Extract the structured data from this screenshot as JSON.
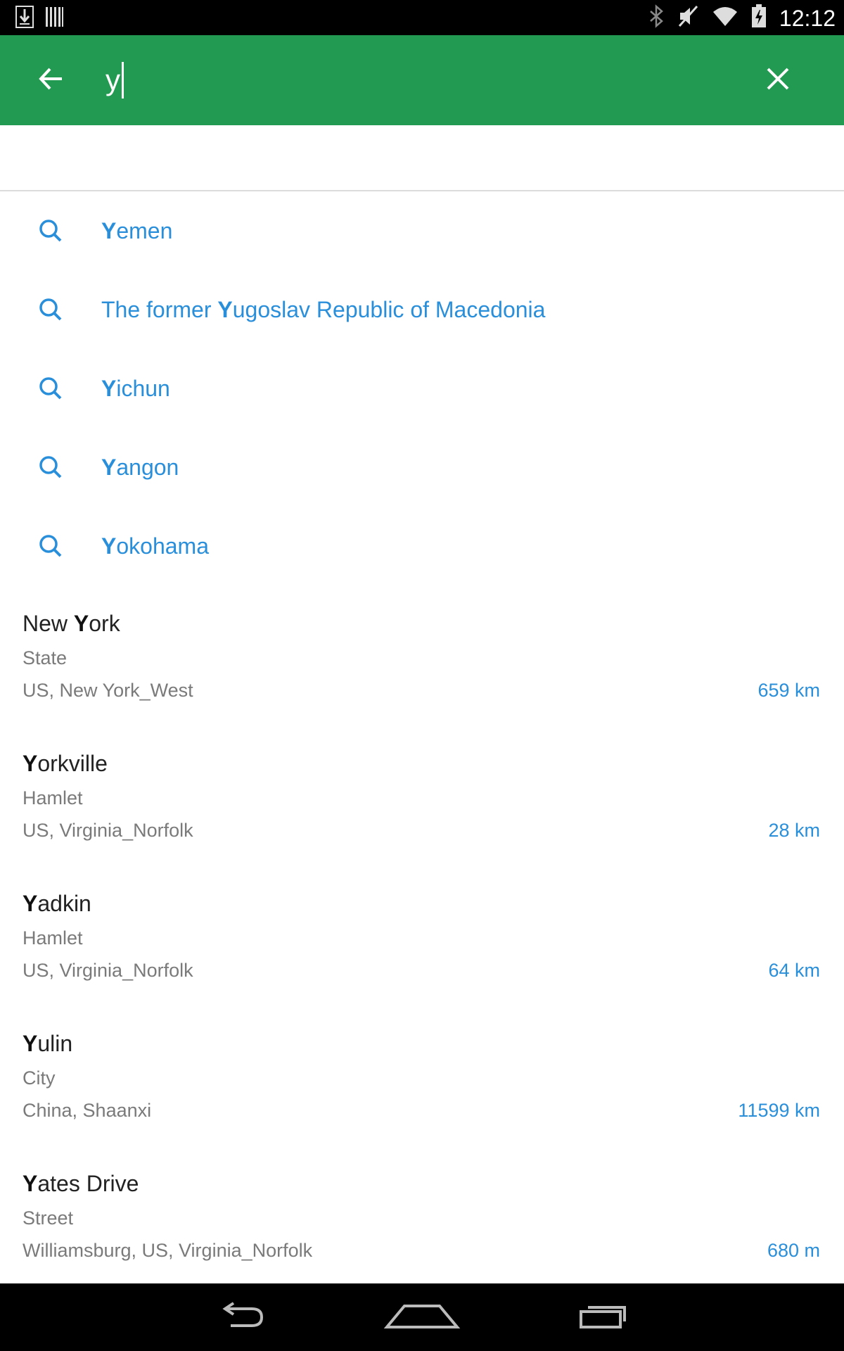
{
  "status_bar": {
    "time": "12:12",
    "left_icons": [
      "download-icon",
      "barcode-icon"
    ],
    "right_icons": [
      "bluetooth-icon",
      "mute-icon",
      "wifi-icon",
      "battery-icon"
    ]
  },
  "toolbar": {
    "back_icon": "arrow-back-icon",
    "search_value": "y",
    "clear_icon": "close-icon",
    "background_color": "#229a52"
  },
  "suggestions": [
    {
      "match": "Y",
      "before": "",
      "after": "emen"
    },
    {
      "match": "Y",
      "before": "The former ",
      "after": "ugoslav Republic of Macedonia"
    },
    {
      "match": "Y",
      "before": "",
      "after": "ichun"
    },
    {
      "match": "Y",
      "before": "",
      "after": "angon"
    },
    {
      "match": "Y",
      "before": "",
      "after": "okohama"
    }
  ],
  "results": [
    {
      "before": "New ",
      "match": "Y",
      "after": "ork",
      "type": "State",
      "region": "US, New York_West",
      "distance": "659 km"
    },
    {
      "before": "",
      "match": "Y",
      "after": "orkville",
      "type": "Hamlet",
      "region": "US, Virginia_Norfolk",
      "distance": "28 km"
    },
    {
      "before": "",
      "match": "Y",
      "after": "adkin",
      "type": "Hamlet",
      "region": "US, Virginia_Norfolk",
      "distance": "64 km"
    },
    {
      "before": "",
      "match": "Y",
      "after": "ulin",
      "type": "City",
      "region": "China, Shaanxi",
      "distance": "11599 km"
    },
    {
      "before": "",
      "match": "Y",
      "after": "ates Drive",
      "type": "Street",
      "region": "Williamsburg, US, Virginia_Norfolk",
      "distance": "680 m"
    }
  ],
  "nav_bar": {
    "icons": [
      "back-nav-icon",
      "home-nav-icon",
      "recents-nav-icon"
    ]
  },
  "colors": {
    "accent": "#2a8fdb",
    "toolbar": "#229a52"
  }
}
